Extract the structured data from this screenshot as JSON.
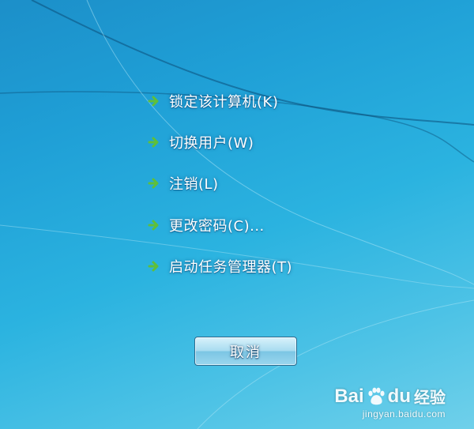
{
  "menu": {
    "items": [
      {
        "label": "锁定该计算机(K)",
        "icon": "green-arrow-icon"
      },
      {
        "label": "切换用户(W)",
        "icon": "green-arrow-icon"
      },
      {
        "label": "注销(L)",
        "icon": "green-arrow-icon"
      },
      {
        "label": "更改密码(C)...",
        "icon": "green-arrow-icon"
      },
      {
        "label": "启动任务管理器(T)",
        "icon": "green-arrow-icon"
      }
    ]
  },
  "cancel_button": {
    "label": "取消"
  },
  "watermark": {
    "brand_left": "Bai",
    "brand_right": "du",
    "brand_cn": "经验",
    "url": "jingyan.baidu.com"
  },
  "colors": {
    "background": "#1f9fd6",
    "arrow_green": "#5fbf3a",
    "text": "#ffffff"
  }
}
